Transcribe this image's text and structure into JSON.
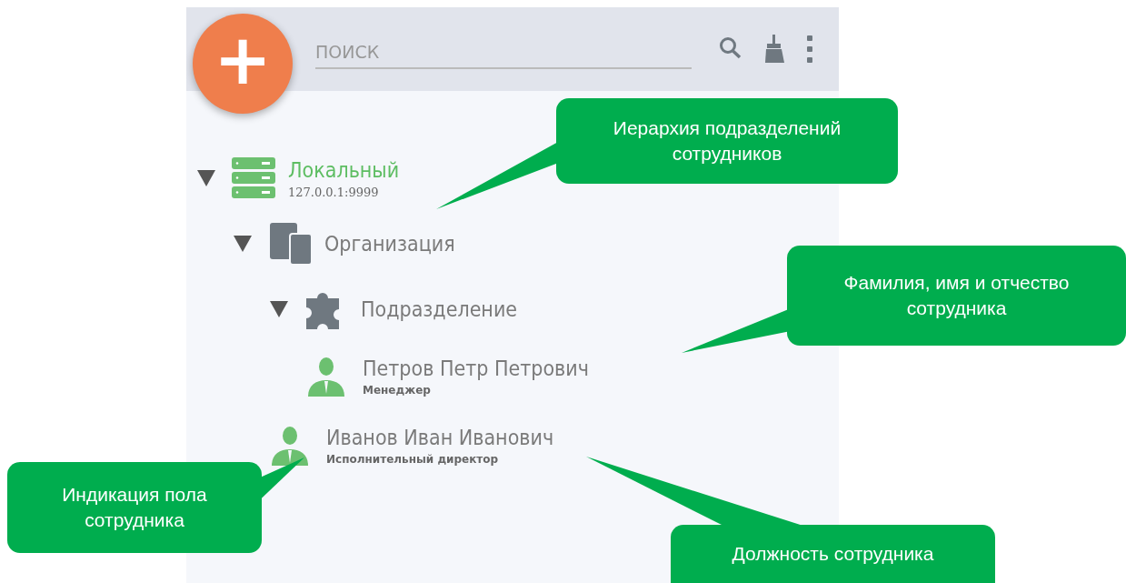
{
  "toolbar": {
    "add_button": "+",
    "search": {
      "placeholder": "ПОИСК"
    }
  },
  "tree": [
    {
      "kind": "server",
      "label": "Локальный",
      "sublabel": "127.0.0.1:9999",
      "expanded": true,
      "children": [
        {
          "kind": "organization",
          "label": "Организация",
          "expanded": true,
          "children": [
            {
              "kind": "department",
              "label": "Подразделение",
              "expanded": true,
              "children": [
                {
                  "kind": "employee",
                  "label": "Петров Петр Петрович",
                  "sublabel": "Менеджер"
                }
              ]
            },
            {
              "kind": "employee",
              "label": "Иванов Иван Иванович",
              "sublabel": "Исполнительный директор"
            }
          ]
        }
      ]
    }
  ],
  "annotations": [
    {
      "text": "Иерархия подразделений сотрудников"
    },
    {
      "text": "Фамилия, имя и отчество сотрудника"
    },
    {
      "text": "Индикация пола сотрудника"
    },
    {
      "text": "Должность сотрудника"
    }
  ]
}
